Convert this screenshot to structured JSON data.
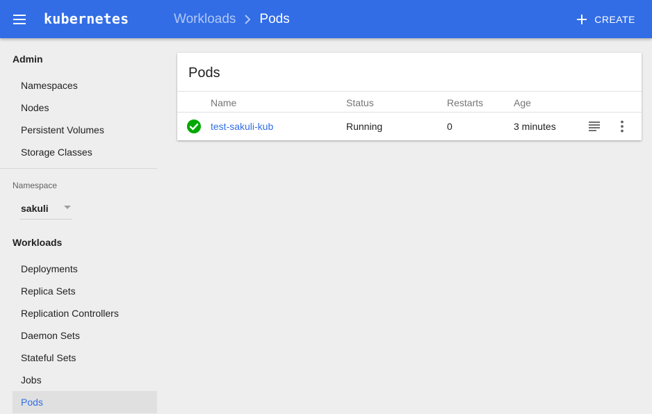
{
  "topbar": {
    "brand": "kubernetes",
    "breadcrumb": {
      "parent": "Workloads",
      "current": "Pods"
    },
    "create_label": "CREATE",
    "color": "#326de6"
  },
  "sidebar": {
    "admin": {
      "heading": "Admin",
      "items": [
        {
          "label": "Namespaces"
        },
        {
          "label": "Nodes"
        },
        {
          "label": "Persistent Volumes"
        },
        {
          "label": "Storage Classes"
        }
      ]
    },
    "namespace": {
      "label": "Namespace",
      "selected": "sakuli"
    },
    "workloads": {
      "heading": "Workloads",
      "items": [
        {
          "label": "Deployments"
        },
        {
          "label": "Replica Sets"
        },
        {
          "label": "Replication Controllers"
        },
        {
          "label": "Daemon Sets"
        },
        {
          "label": "Stateful Sets"
        },
        {
          "label": "Jobs"
        },
        {
          "label": "Pods",
          "active": true
        }
      ]
    }
  },
  "main": {
    "card_title": "Pods",
    "columns": [
      "Name",
      "Status",
      "Restarts",
      "Age"
    ],
    "rows": [
      {
        "status_icon": "check-circle-icon",
        "name": "test-sakuli-kub",
        "status": "Running",
        "restarts": "0",
        "age": "3 minutes"
      }
    ],
    "status_ok_color": "#00a800"
  }
}
